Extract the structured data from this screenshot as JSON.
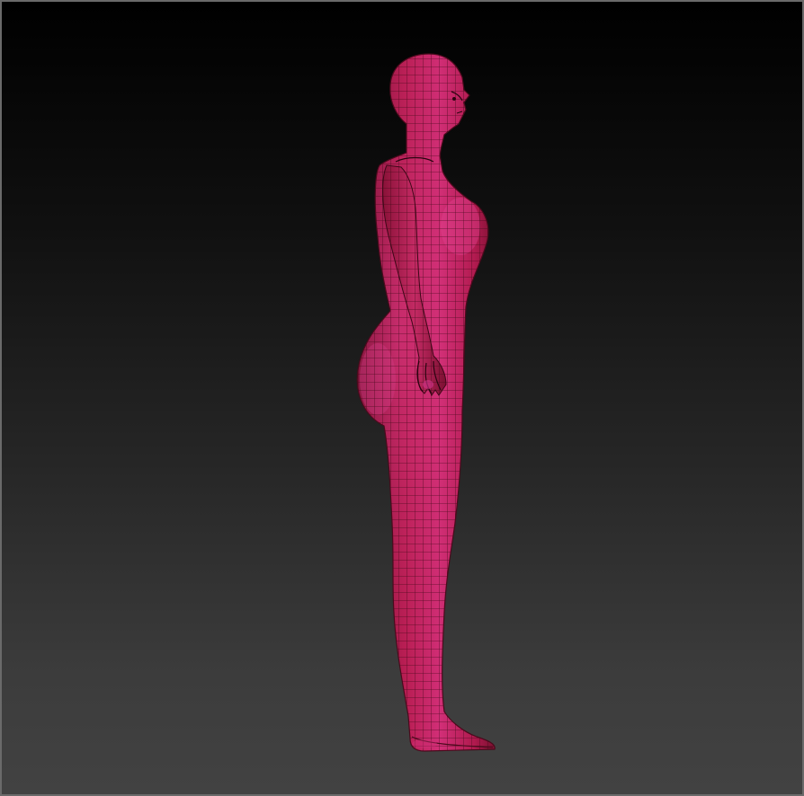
{
  "viewport": {
    "background_top": "#000000",
    "background_bottom": "#424242",
    "border_color": "#6a6a6a"
  },
  "model": {
    "surface_color": "#b81d52",
    "highlight_color": "#e0408e",
    "shadow_color": "#6e0e2c",
    "wireframe_color": "#3a0714",
    "view": "side-profile",
    "display_mode": "polyframe"
  }
}
